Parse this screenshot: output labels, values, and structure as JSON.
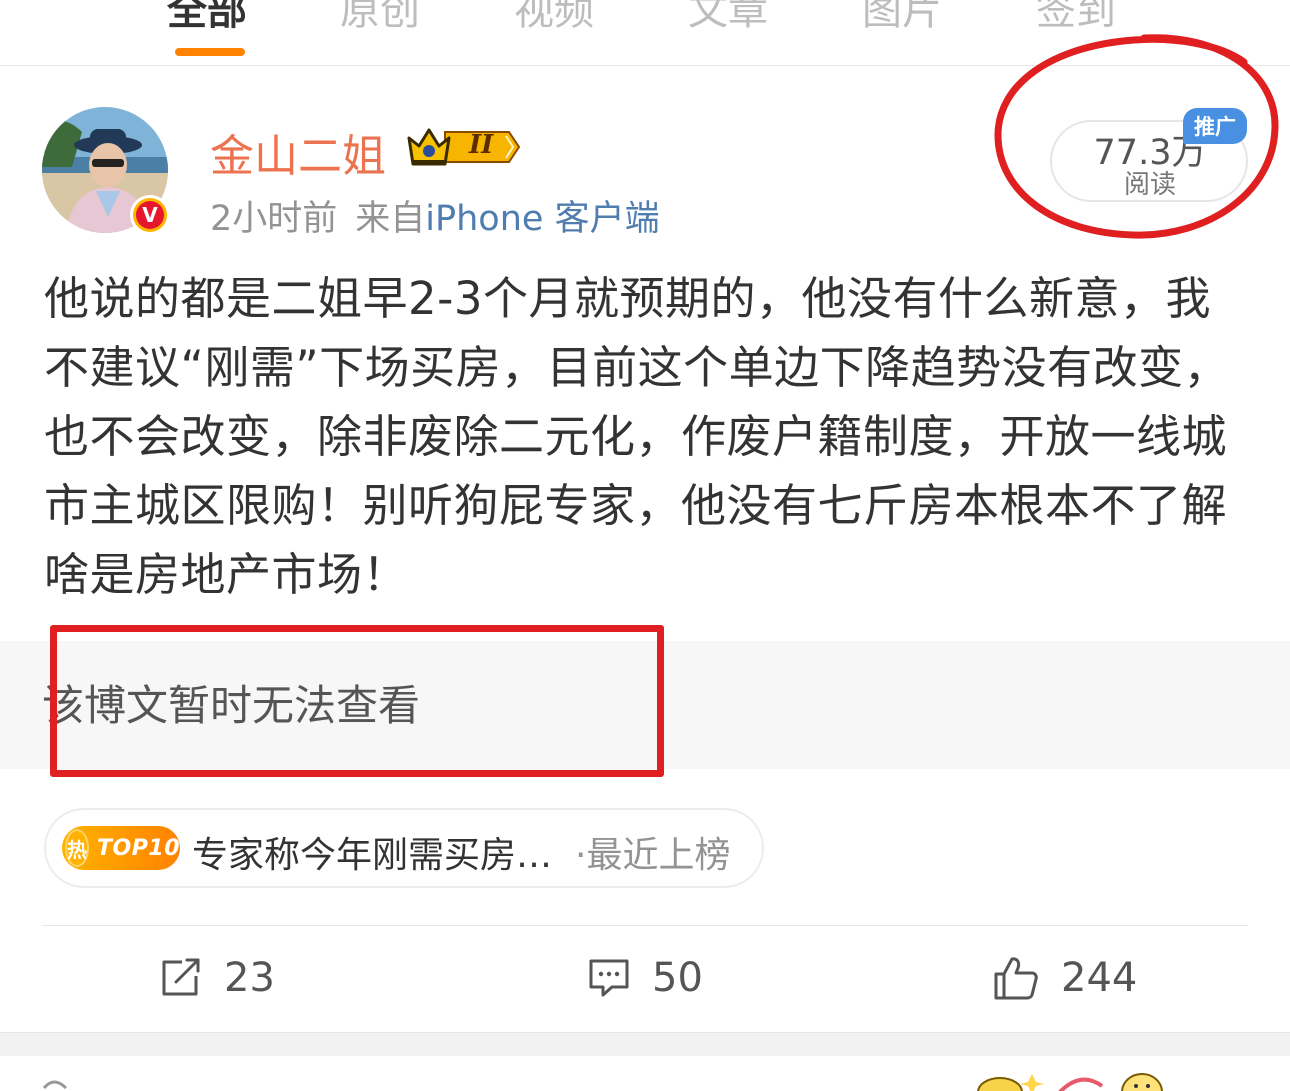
{
  "tabs": [
    "全部",
    "原创",
    "视频",
    "文章",
    "图片",
    "签到"
  ],
  "post": {
    "username": "金山二姐",
    "member_level": "II",
    "verified_mark": "V",
    "time": "2小时前",
    "from_label": "来自",
    "client": "iPhone 客户端",
    "reads": {
      "count": "77.3万",
      "label": "阅读",
      "promo_tag": "推广"
    },
    "text": "他说的都是二姐早2-3个月就预期的，他没有什么新意，我不建议“刚需”下场买房，目前这个单边下降趋势没有改变，也不会改变，除非废除二元化，作废户籍制度，开放一线城市主城区限购！别听狗屁专家，他没有七斤房本根本不了解啥是房地产市场！",
    "unavailable_text": "该博文暂时无法查看",
    "hot": {
      "badge_char": "热",
      "badge_label": "TOP10",
      "title": "专家称今年刚需买房…",
      "status": "·最近上榜"
    },
    "actions": {
      "repost_count": "23",
      "comment_count": "50",
      "like_count": "244"
    }
  },
  "icons": [
    "repost-icon",
    "comment-icon",
    "like-icon",
    "crown-icon",
    "verified-icon"
  ],
  "colors": {
    "accent": "#ff8200",
    "username": "#eb7350",
    "link": "#507daf",
    "annotation": "#e02020",
    "promo": "#4a90e2"
  }
}
